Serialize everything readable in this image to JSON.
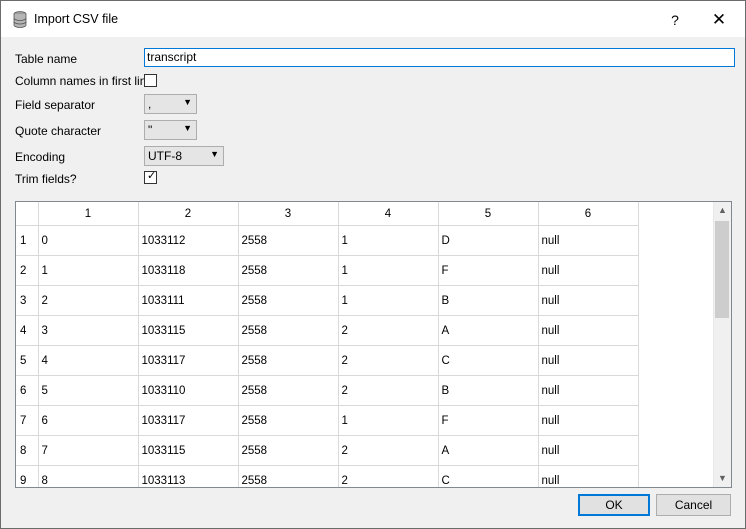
{
  "window": {
    "title": "Import CSV file",
    "help_label": "?",
    "close_label": "✕"
  },
  "form": {
    "table_name_label": "Table name",
    "table_name_value": "transcript",
    "column_names_label": "Column names in first line",
    "column_names_checked": false,
    "field_separator_label": "Field separator",
    "field_separator_value": ",",
    "quote_character_label": "Quote character",
    "quote_character_value": "\"",
    "encoding_label": "Encoding",
    "encoding_value": "UTF-8",
    "trim_fields_label": "Trim fields?",
    "trim_fields_checked": true
  },
  "preview": {
    "columns": [
      "1",
      "2",
      "3",
      "4",
      "5",
      "6"
    ],
    "rows": [
      {
        "num": "1",
        "cells": [
          "0",
          "1033112",
          "2558",
          "1",
          "D",
          "null"
        ]
      },
      {
        "num": "2",
        "cells": [
          "1",
          "1033118",
          "2558",
          "1",
          "F",
          "null"
        ]
      },
      {
        "num": "3",
        "cells": [
          "2",
          "1033111",
          "2558",
          "1",
          "B",
          "null"
        ]
      },
      {
        "num": "4",
        "cells": [
          "3",
          "1033115",
          "2558",
          "2",
          "A",
          "null"
        ]
      },
      {
        "num": "5",
        "cells": [
          "4",
          "1033117",
          "2558",
          "2",
          "C",
          "null"
        ]
      },
      {
        "num": "6",
        "cells": [
          "5",
          "1033110",
          "2558",
          "2",
          "B",
          "null"
        ]
      },
      {
        "num": "7",
        "cells": [
          "6",
          "1033117",
          "2558",
          "1",
          "F",
          "null"
        ]
      },
      {
        "num": "8",
        "cells": [
          "7",
          "1033115",
          "2558",
          "2",
          "A",
          "null"
        ]
      },
      {
        "num": "9",
        "cells": [
          "8",
          "1033113",
          "2558",
          "2",
          "C",
          "null"
        ]
      }
    ]
  },
  "buttons": {
    "ok_label": "OK",
    "cancel_label": "Cancel"
  },
  "icons": {
    "title": "database-icon",
    "scroll_up": "chevron-up-icon",
    "scroll_down": "chevron-down-icon",
    "combo": "dropdown-arrow-icon"
  }
}
